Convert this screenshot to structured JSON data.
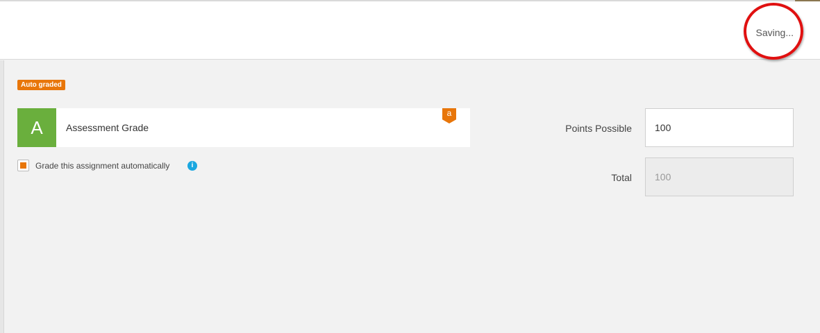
{
  "header": {
    "status_text": "Saving..."
  },
  "badge": {
    "label": "Auto graded",
    "color": "#e8760a"
  },
  "grade_card": {
    "letter": "A",
    "title": "Assessment Grade",
    "letter_bg": "#6aaf3d",
    "corner_tag": "a"
  },
  "auto_grade": {
    "checked": true,
    "label": "Grade this assignment automatically",
    "info_icon": "info-icon",
    "info_glyph": "i"
  },
  "fields": {
    "points_possible": {
      "label": "Points Possible",
      "value": "100"
    },
    "total": {
      "label": "Total",
      "value": "100"
    }
  }
}
